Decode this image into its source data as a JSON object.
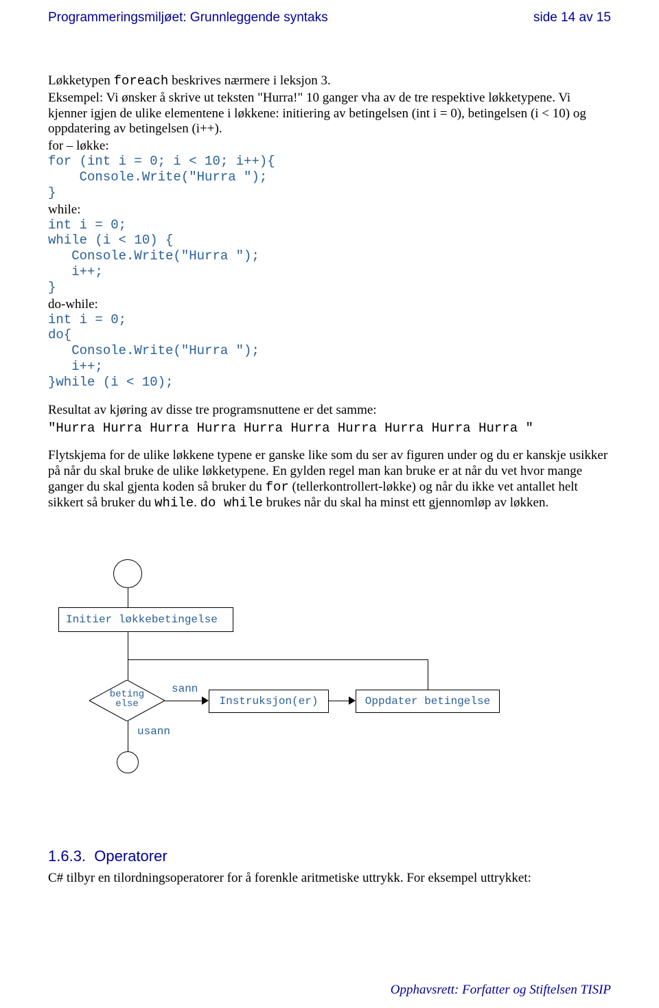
{
  "header": {
    "left": "Programmeringsmiljøet: Grunnleggende syntaks",
    "right": "side 14 av 15"
  },
  "intro": {
    "p1a": "Løkketypen ",
    "p1_mono": "foreach",
    "p1b": " beskrives nærmere i leksjon 3.",
    "p2": "Eksempel: Vi ønsker å skrive ut teksten \"Hurra!\" 10 ganger vha av de tre respektive løkketypene. Vi kjenner igjen de ulike elementene i løkkene: initiering av betingelsen (int i = 0), betingelsen (i < 10) og oppdatering av betingelsen (i++)."
  },
  "for_section": {
    "label": "for – løkke:",
    "code": "for (int i = 0; i < 10; i++){\n    Console.Write(\"Hurra \");\n}"
  },
  "while_section": {
    "label": "while:",
    "code": "int i = 0;\nwhile (i < 10) {\n   Console.Write(\"Hurra \");\n   i++;\n}"
  },
  "dowhile_section": {
    "label": "do-while:",
    "code": "int i = 0;\ndo{\n   Console.Write(\"Hurra \");\n   i++;\n}while (i < 10);"
  },
  "result": {
    "label": "Resultat av kjøring av disse tre programsnuttene er det samme:",
    "output": "\"Hurra Hurra Hurra Hurra Hurra Hurra Hurra Hurra Hurra Hurra \""
  },
  "explain": {
    "p1a": "Flytskjema for de ulike løkkene typene er ganske like som du ser av figuren under og du er kanskje usikker på når du skal bruke de ulike løkketypene. En gylden regel man kan bruke er at når du vet hvor mange ganger du skal gjenta koden så bruker du ",
    "p1_mono1": "for",
    "p1b": " (tellerkontrollert-løkke) og når du ikke vet antallet helt sikkert så bruker du ",
    "p1_mono2": "while",
    "p1c": ". ",
    "p1_mono3": "do while",
    "p1d": " brukes når du skal ha minst ett gjennomløp av løkken."
  },
  "flowchart": {
    "init": "Initier løkkebetingelse",
    "cond1": "beting",
    "cond2": "else",
    "sann": "sann",
    "usann": "usann",
    "instr": "Instruksjon(er)",
    "update": "Oppdater betingelse"
  },
  "subsection": {
    "num": "1.6.3.",
    "title": "Operatorer",
    "text": "C# tilbyr en tilordningsoperatorer for å forenkle aritmetiske uttrykk. For eksempel uttrykket:"
  },
  "footer": "Opphavsrett:  Forfatter og Stiftelsen TISIP"
}
